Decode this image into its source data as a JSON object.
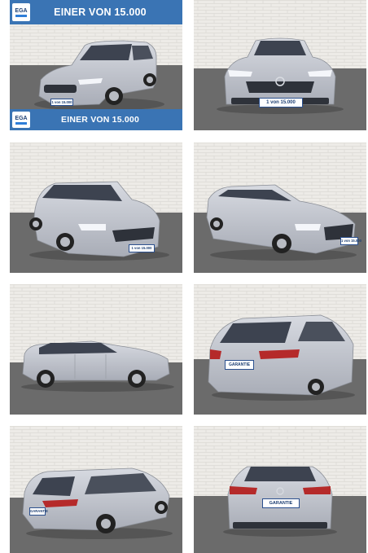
{
  "banner": {
    "text": "EINER VON 15.000",
    "logo": "EGA"
  },
  "plates": {
    "front": "1 von 15.000",
    "rear": "GARANTIE"
  },
  "colors": {
    "banner": "#3a74b4",
    "car": "#c2c6cf",
    "wall": "#eceae6",
    "floor": "#6a6a6a"
  },
  "gallery": {
    "photos": [
      {
        "view": "front-left"
      },
      {
        "view": "front"
      },
      {
        "view": "front-right"
      },
      {
        "view": "front-left"
      },
      {
        "view": "left-side"
      },
      {
        "view": "rear-right"
      },
      {
        "view": "rear-left"
      },
      {
        "view": "rear"
      }
    ]
  }
}
